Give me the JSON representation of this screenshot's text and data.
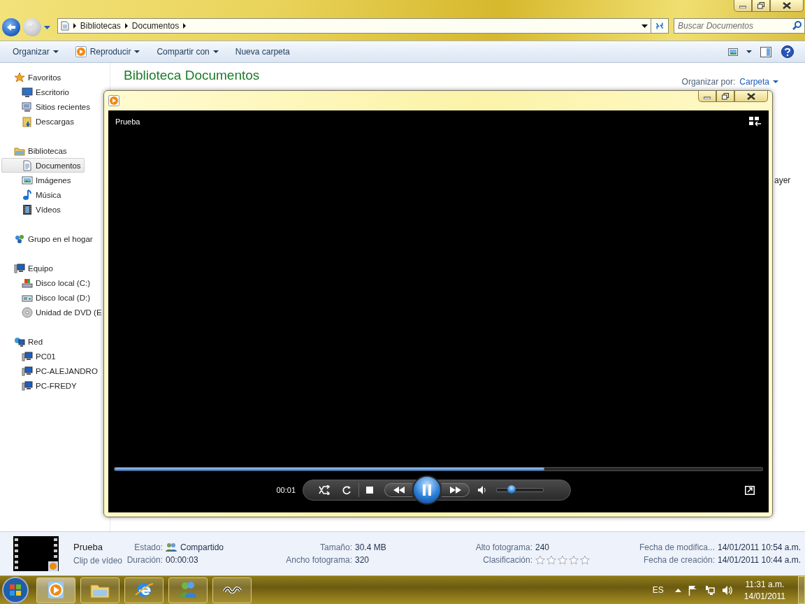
{
  "explorer": {
    "breadcrumb": [
      "Bibliotecas",
      "Documentos"
    ],
    "search": {
      "placeholder": "Buscar Documentos"
    },
    "toolbar": [
      {
        "label": "Organizar",
        "kind": "menu"
      },
      {
        "label": "Reproducir",
        "kind": "play"
      },
      {
        "label": "Compartir con",
        "kind": "menu"
      },
      {
        "label": "Nueva carpeta",
        "kind": "plain"
      }
    ],
    "nav": [
      {
        "label": "Favoritos",
        "kind": "star",
        "selected": false,
        "children": [
          {
            "label": "Escritorio",
            "kind": "desktop",
            "selected": false
          },
          {
            "label": "Sitios recientes",
            "kind": "recent",
            "selected": false
          },
          {
            "label": "Descargas",
            "kind": "downloads",
            "selected": false
          }
        ]
      },
      {
        "label": "Bibliotecas",
        "kind": "library",
        "selected": false,
        "children": [
          {
            "label": "Documentos",
            "kind": "document",
            "selected": true
          },
          {
            "label": "Imágenes",
            "kind": "images",
            "selected": false
          },
          {
            "label": "Música",
            "kind": "music",
            "selected": false
          },
          {
            "label": "Vídeos",
            "kind": "videos",
            "selected": false
          }
        ]
      },
      {
        "label": "Grupo en el hogar",
        "kind": "homegroup",
        "selected": false
      },
      {
        "label": "Equipo",
        "kind": "computer",
        "selected": false,
        "children": [
          {
            "label": "Disco local (C:)",
            "kind": "disk",
            "selected": false
          },
          {
            "label": "Disco local (D:)",
            "kind": "disk2",
            "selected": false
          },
          {
            "label": "Unidad de DVD (E",
            "kind": "dvd",
            "selected": false
          }
        ]
      },
      {
        "label": "Red",
        "kind": "network",
        "selected": false,
        "children": [
          {
            "label": "PC01",
            "kind": "pc",
            "selected": false
          },
          {
            "label": "PC-ALEJANDRO",
            "kind": "pc",
            "selected": false
          },
          {
            "label": "PC-FREDY",
            "kind": "pc",
            "selected": false
          }
        ]
      }
    ],
    "library": {
      "title": "Biblioteca Documentos",
      "arrange_label": "Organizar por:",
      "arrange_value": "Carpeta"
    },
    "partial_text": "ayer"
  },
  "player": {
    "title": "Prueba",
    "progress": {
      "level": 0.663
    },
    "time": "00:01",
    "playing": true,
    "volume": {
      "level": 0.32
    }
  },
  "details": {
    "name": "Prueba",
    "type": "Clip de vídeo",
    "columns": [
      {
        "props": [
          {
            "label": "Estado:",
            "value": "Compartido",
            "kind": "shared"
          },
          {
            "label": "Duración:",
            "value": "00:00:03",
            "kind": "text"
          }
        ]
      },
      {
        "props": [
          {
            "label": "Tamaño:",
            "value": "30.4 MB",
            "kind": "text"
          },
          {
            "label": "Ancho fotograma:",
            "value": "320",
            "kind": "text"
          }
        ]
      },
      {
        "props": [
          {
            "label": "Alto fotograma:",
            "value": "240",
            "kind": "text"
          },
          {
            "label": "Clasificación:",
            "kind": "stars",
            "stars": 0
          }
        ]
      },
      {
        "props": [
          {
            "label": "Fecha de modifica...",
            "value": "14/01/2011 10:54 a.m.",
            "kind": "text"
          },
          {
            "label": "Fecha de creación:",
            "value": "14/01/2011 10:44 a.m.",
            "kind": "text"
          }
        ]
      }
    ]
  },
  "taskbar": {
    "buttons": [
      {
        "kind": "player",
        "selected": true
      },
      {
        "kind": "explorer",
        "selected": false
      },
      {
        "kind": "browser",
        "selected": false
      },
      {
        "kind": "messenger",
        "selected": false
      },
      {
        "kind": "tool",
        "selected": false
      }
    ],
    "language": "ES",
    "time": "11:31 a.m.",
    "date": "14/01/2011"
  }
}
